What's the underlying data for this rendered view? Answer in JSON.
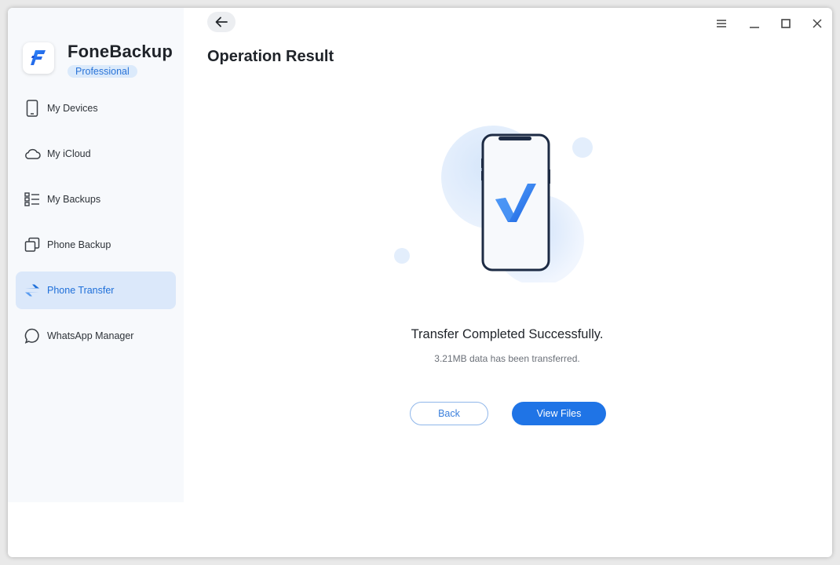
{
  "app": {
    "name": "FoneBackup",
    "edition": "Professional"
  },
  "sidebar": {
    "items": [
      {
        "label": "My Devices",
        "icon": "phone-outline-icon",
        "active": false
      },
      {
        "label": "My iCloud",
        "icon": "cloud-icon",
        "active": false
      },
      {
        "label": "My Backups",
        "icon": "list-icon",
        "active": false
      },
      {
        "label": "Phone Backup",
        "icon": "copy-icon",
        "active": false
      },
      {
        "label": "Phone Transfer",
        "icon": "transfer-arrows-icon",
        "active": true
      },
      {
        "label": "WhatsApp Manager",
        "icon": "chat-bubble-icon",
        "active": false
      }
    ]
  },
  "header": {
    "title": "Operation Result"
  },
  "result": {
    "title": "Transfer Completed Successfully.",
    "subtitle": "3.21MB data has been transferred."
  },
  "buttons": {
    "back": "Back",
    "view_files": "View Files"
  },
  "colors": {
    "accent": "#1f74e6",
    "active_nav_bg": "#dbe8fa",
    "sidebar_bg": "#f7f9fc"
  }
}
